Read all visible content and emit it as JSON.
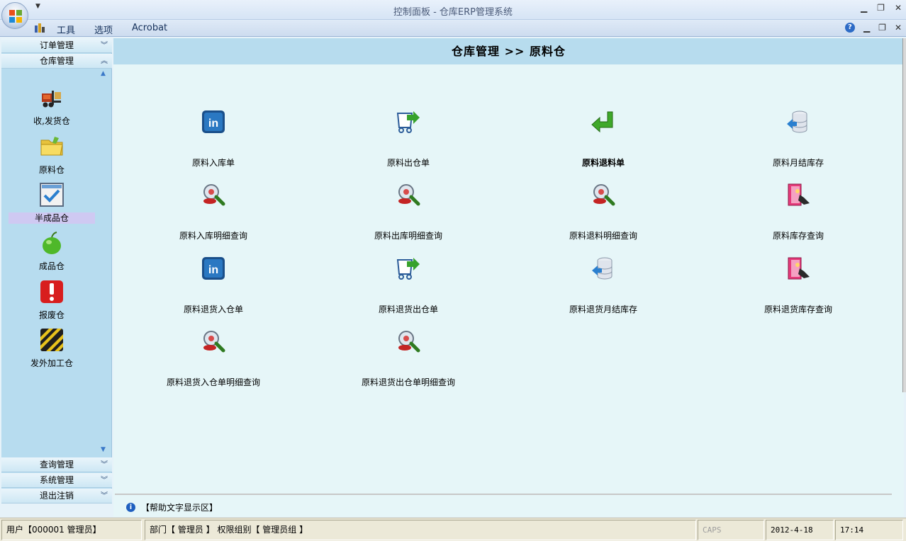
{
  "window": {
    "title": "控制面板 - 仓库ERP管理系统"
  },
  "menu": {
    "items": [
      "工具",
      "选项",
      "Acrobat"
    ]
  },
  "sidebar": {
    "sections": [
      {
        "label": "订单管理"
      },
      {
        "label": "仓库管理"
      },
      {
        "label": "查询管理"
      },
      {
        "label": "系统管理"
      },
      {
        "label": "退出注销"
      }
    ],
    "items": [
      {
        "label": "收,发货仓",
        "icon": "forklift-icon"
      },
      {
        "label": "原料仓",
        "icon": "folder-icon"
      },
      {
        "label": "半成品仓",
        "icon": "checkbox-icon",
        "selected": true
      },
      {
        "label": "成品仓",
        "icon": "apple-icon"
      },
      {
        "label": "报废仓",
        "icon": "warning-icon"
      },
      {
        "label": "发外加工仓",
        "icon": "hazard-stripes-icon"
      }
    ]
  },
  "main": {
    "breadcrumb": "仓库管理 >> 原料仓",
    "tiles": [
      {
        "label": "原料入库单",
        "icon": "in-icon"
      },
      {
        "label": "原料出仓单",
        "icon": "cart-out-icon"
      },
      {
        "label": "原料退料单",
        "icon": "return-arrow-icon",
        "bold": true
      },
      {
        "label": "原料月结库存",
        "icon": "database-arrow-icon"
      },
      {
        "label": "原料入库明细查询",
        "icon": "search-user-icon"
      },
      {
        "label": "原料出库明细查询",
        "icon": "search-user-icon"
      },
      {
        "label": "原料退料明细查询",
        "icon": "search-user-icon"
      },
      {
        "label": "原料库存查询",
        "icon": "door-exit-icon"
      },
      {
        "label": "原料退货入仓单",
        "icon": "in-icon"
      },
      {
        "label": "原料退货出仓单",
        "icon": "cart-out-icon"
      },
      {
        "label": "原料退货月结库存",
        "icon": "database-arrow-icon"
      },
      {
        "label": "原料退货库存查询",
        "icon": "door-exit-icon"
      },
      {
        "label": "原料退货入仓单明细查询",
        "icon": "search-user-icon"
      },
      {
        "label": "原料退货出仓单明细查询",
        "icon": "search-user-icon"
      }
    ],
    "help_text": "【帮助文字显示区】"
  },
  "status": {
    "user": "用户【000001 管理员】",
    "dept": "部门【 管理员 】 权限组别【 管理员组 】",
    "caps": "CAPS",
    "date": "2012-4-18",
    "time": "17:14"
  },
  "colors": {
    "sidebar_bg": "#b7dcef",
    "header_bg": "#b7dcee",
    "selected": "#cfc9f2"
  }
}
